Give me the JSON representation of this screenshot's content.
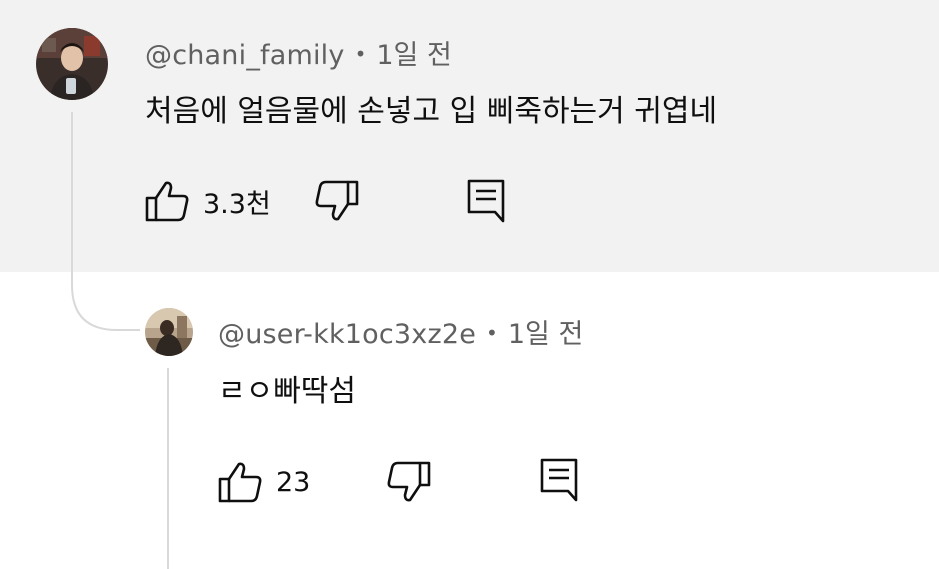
{
  "comment": {
    "handle": "@chani_family",
    "separator": "•",
    "time": "1일 전",
    "text": "처음에 얼음물에 손넣고 입 삐죽하는거 귀엽네",
    "like_count": "3.3천",
    "icons": {
      "like": "thumb-up-icon",
      "dislike": "thumb-down-icon",
      "reply": "reply-icon"
    }
  },
  "reply": {
    "handle": "@user-kk1oc3xz2e",
    "separator": "•",
    "time": "1일 전",
    "text": "ㄹㅇ빠딱섬",
    "like_count": "23",
    "icons": {
      "like": "thumb-up-icon",
      "dislike": "thumb-down-icon",
      "reply": "reply-icon"
    }
  },
  "colors": {
    "parent_background": "#f2f2f2",
    "secondary_text": "#606060",
    "thread_line": "#d9d9d9"
  }
}
